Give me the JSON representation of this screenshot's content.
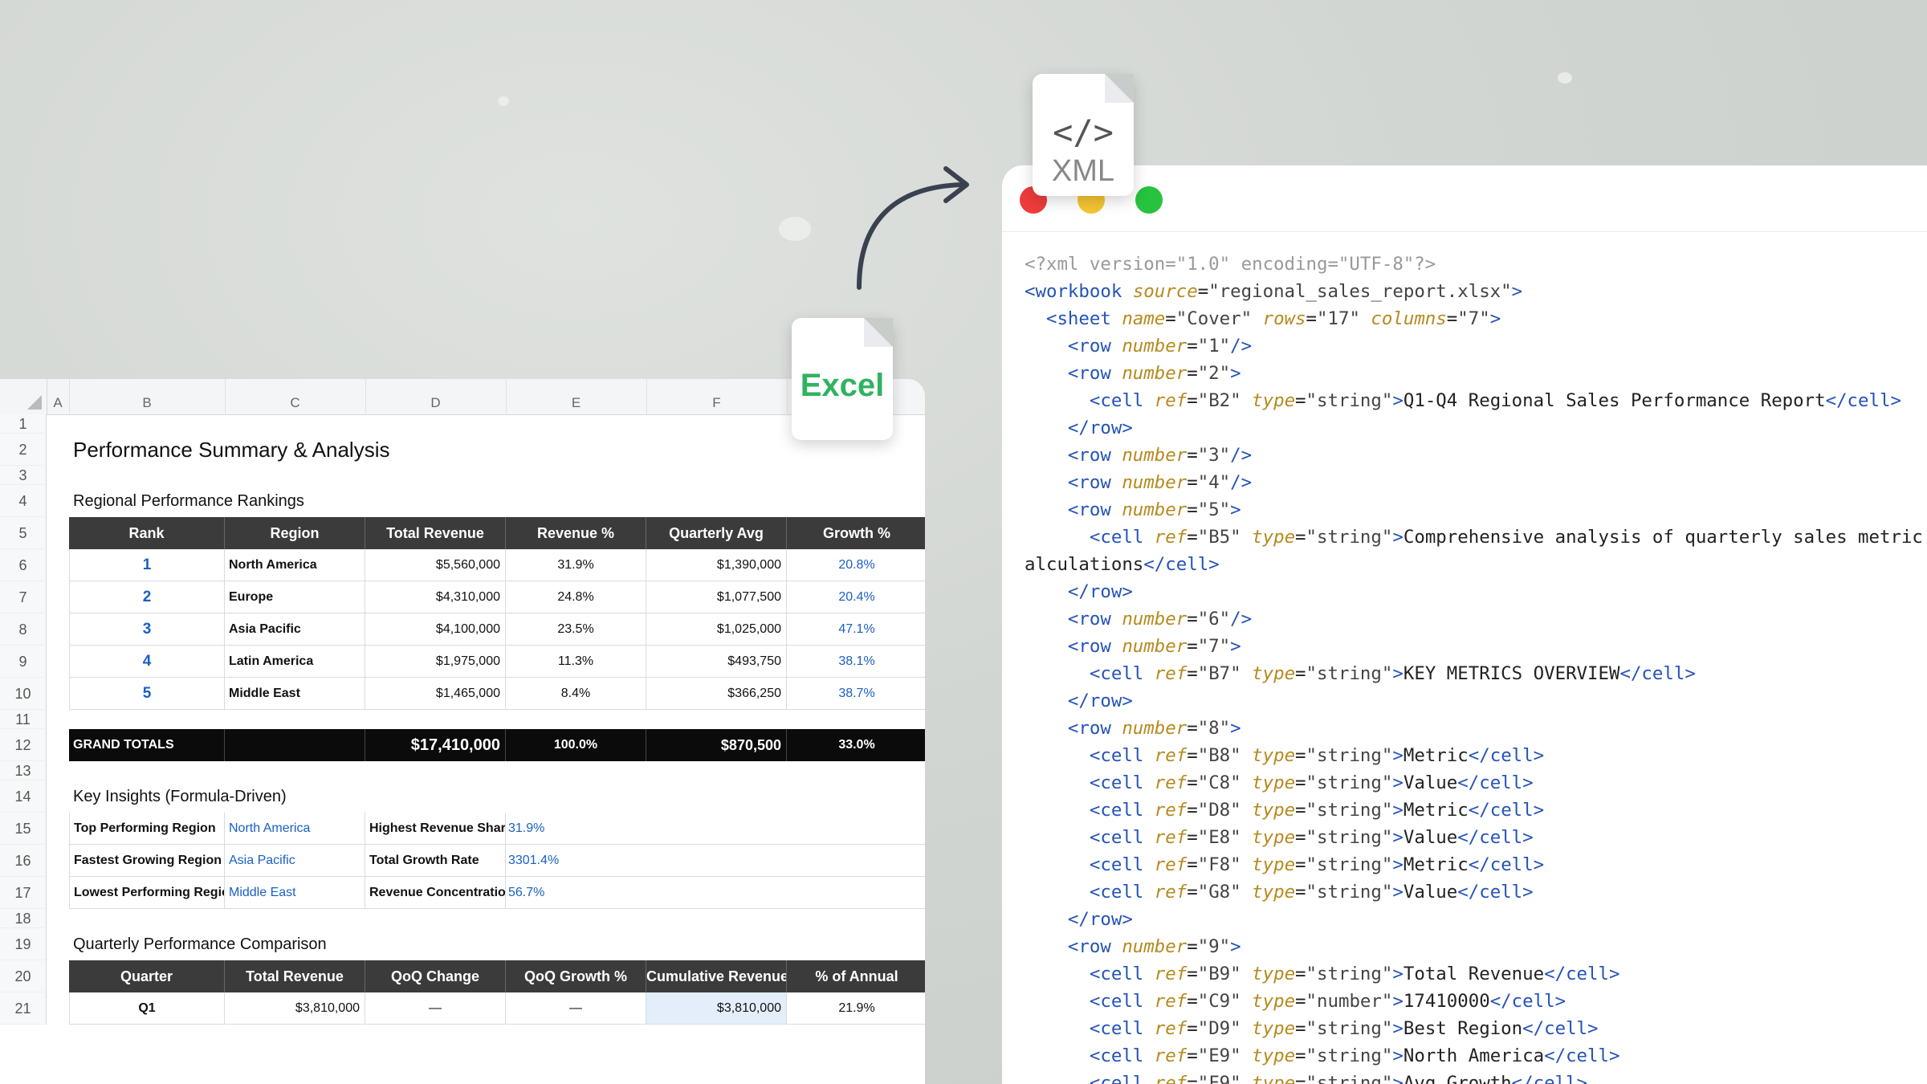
{
  "colors": {
    "accent_blue": "#1a5fc4",
    "header_dark": "#3b3b3b",
    "totals_black": "#0b0b0b",
    "excel_green": "#2fb360",
    "xml_tag": "#2453b8",
    "xml_attr": "#b58a1e",
    "mac_red": "#ee3b3b",
    "mac_yellow": "#f5c531",
    "mac_green": "#27c23e"
  },
  "icons": {
    "excel_badge": "excel-file-icon",
    "xml_badge": "xml-file-icon",
    "arrow": "curved-arrow-icon",
    "xml_code_glyph": "</>"
  },
  "excel_badge_label": "Excel",
  "xml_badge_label": "XML",
  "sheet": {
    "columns": [
      "A",
      "B",
      "C",
      "D",
      "E",
      "F"
    ],
    "rows": [
      "1",
      "2",
      "3",
      "4",
      "5",
      "6",
      "7",
      "8",
      "9",
      "10",
      "11",
      "12",
      "13",
      "14",
      "15",
      "16",
      "17",
      "18",
      "19",
      "20",
      "21"
    ],
    "title": "Performance Summary & Analysis",
    "rankings_title": "Regional Performance Rankings",
    "rankings_headers": [
      "Rank",
      "Region",
      "Total Revenue",
      "Revenue %",
      "Quarterly Avg",
      "Growth %"
    ],
    "rankings": [
      {
        "rank": "1",
        "region": "North America",
        "revenue": "$5,560,000",
        "pct": "31.9%",
        "avg": "$1,390,000",
        "growth": "20.8%"
      },
      {
        "rank": "2",
        "region": "Europe",
        "revenue": "$4,310,000",
        "pct": "24.8%",
        "avg": "$1,077,500",
        "growth": "20.4%"
      },
      {
        "rank": "3",
        "region": "Asia Pacific",
        "revenue": "$4,100,000",
        "pct": "23.5%",
        "avg": "$1,025,000",
        "growth": "47.1%"
      },
      {
        "rank": "4",
        "region": "Latin America",
        "revenue": "$1,975,000",
        "pct": "11.3%",
        "avg": "$493,750",
        "growth": "38.1%"
      },
      {
        "rank": "5",
        "region": "Middle East",
        "revenue": "$1,465,000",
        "pct": "8.4%",
        "avg": "$366,250",
        "growth": "38.7%"
      }
    ],
    "totals": {
      "label": "GRAND TOTALS",
      "revenue": "$17,410,000",
      "pct": "100.0%",
      "avg": "$870,500",
      "growth": "33.0%"
    },
    "insights_title": "Key Insights (Formula-Driven)",
    "insights": [
      {
        "k1": "Top Performing Region",
        "v1": "North America",
        "k2": "Highest Revenue Share",
        "v2": "31.9%"
      },
      {
        "k1": "Fastest Growing Region",
        "v1": "Asia Pacific",
        "k2": "Total Growth Rate",
        "v2": "3301.4%"
      },
      {
        "k1": "Lowest Performing Region",
        "v1": "Middle East",
        "k2": "Revenue Concentration",
        "v2": "56.7%"
      }
    ],
    "quarterly_title": "Quarterly Performance Comparison",
    "quarterly_headers": [
      "Quarter",
      "Total Revenue",
      "QoQ Change",
      "QoQ Growth %",
      "Cumulative Revenue",
      "% of Annual"
    ],
    "quarterly": [
      {
        "q": "Q1",
        "rev": "$3,810,000",
        "chg": "—",
        "gr": "—",
        "cum": "$3,810,000",
        "ann": "21.9%"
      }
    ]
  },
  "xml_lines": [
    [
      [
        "g",
        "<?xml version=\"1.0\" encoding=\"UTF-8\"?>"
      ]
    ],
    [
      [
        "t",
        "<workbook "
      ],
      [
        "a",
        "source"
      ],
      [
        "tx",
        "="
      ],
      [
        "v",
        "\"regional_sales_report.xlsx\""
      ],
      [
        "t",
        ">"
      ]
    ],
    [
      [
        "tx",
        "  "
      ],
      [
        "t",
        "<sheet "
      ],
      [
        "a",
        "name"
      ],
      [
        "tx",
        "="
      ],
      [
        "v",
        "\"Cover\" "
      ],
      [
        "a",
        "rows"
      ],
      [
        "tx",
        "="
      ],
      [
        "v",
        "\"17\" "
      ],
      [
        "a",
        "columns"
      ],
      [
        "tx",
        "="
      ],
      [
        "v",
        "\"7\""
      ],
      [
        "t",
        ">"
      ]
    ],
    [
      [
        "tx",
        "    "
      ],
      [
        "t",
        "<row "
      ],
      [
        "a",
        "number"
      ],
      [
        "tx",
        "="
      ],
      [
        "v",
        "\"1\""
      ],
      [
        "t",
        "/>"
      ]
    ],
    [
      [
        "tx",
        "    "
      ],
      [
        "t",
        "<row "
      ],
      [
        "a",
        "number"
      ],
      [
        "tx",
        "="
      ],
      [
        "v",
        "\"2\""
      ],
      [
        "t",
        ">"
      ]
    ],
    [
      [
        "tx",
        "      "
      ],
      [
        "t",
        "<cell "
      ],
      [
        "a",
        "ref"
      ],
      [
        "tx",
        "="
      ],
      [
        "v",
        "\"B2\" "
      ],
      [
        "a",
        "type"
      ],
      [
        "tx",
        "="
      ],
      [
        "v",
        "\"string\""
      ],
      [
        "t",
        ">"
      ],
      [
        "tx",
        "Q1-Q4 Regional Sales Performance Report"
      ],
      [
        "t",
        "</cell>"
      ]
    ],
    [
      [
        "tx",
        "    "
      ],
      [
        "t",
        "</row>"
      ]
    ],
    [
      [
        "tx",
        "    "
      ],
      [
        "t",
        "<row "
      ],
      [
        "a",
        "number"
      ],
      [
        "tx",
        "="
      ],
      [
        "v",
        "\"3\""
      ],
      [
        "t",
        "/>"
      ]
    ],
    [
      [
        "tx",
        "    "
      ],
      [
        "t",
        "<row "
      ],
      [
        "a",
        "number"
      ],
      [
        "tx",
        "="
      ],
      [
        "v",
        "\"4\""
      ],
      [
        "t",
        "/>"
      ]
    ],
    [
      [
        "tx",
        "    "
      ],
      [
        "t",
        "<row "
      ],
      [
        "a",
        "number"
      ],
      [
        "tx",
        "="
      ],
      [
        "v",
        "\"5\""
      ],
      [
        "t",
        ">"
      ]
    ],
    [
      [
        "tx",
        "      "
      ],
      [
        "t",
        "<cell "
      ],
      [
        "a",
        "ref"
      ],
      [
        "tx",
        "="
      ],
      [
        "v",
        "\"B5\" "
      ],
      [
        "a",
        "type"
      ],
      [
        "tx",
        "="
      ],
      [
        "v",
        "\"string\""
      ],
      [
        "t",
        ">"
      ],
      [
        "tx",
        "Comprehensive analysis of quarterly sales metric"
      ]
    ],
    [
      [
        "tx",
        "alculations"
      ],
      [
        "t",
        "</cell>"
      ]
    ],
    [
      [
        "tx",
        "    "
      ],
      [
        "t",
        "</row>"
      ]
    ],
    [
      [
        "tx",
        "    "
      ],
      [
        "t",
        "<row "
      ],
      [
        "a",
        "number"
      ],
      [
        "tx",
        "="
      ],
      [
        "v",
        "\"6\""
      ],
      [
        "t",
        "/>"
      ]
    ],
    [
      [
        "tx",
        "    "
      ],
      [
        "t",
        "<row "
      ],
      [
        "a",
        "number"
      ],
      [
        "tx",
        "="
      ],
      [
        "v",
        "\"7\""
      ],
      [
        "t",
        ">"
      ]
    ],
    [
      [
        "tx",
        "      "
      ],
      [
        "t",
        "<cell "
      ],
      [
        "a",
        "ref"
      ],
      [
        "tx",
        "="
      ],
      [
        "v",
        "\"B7\" "
      ],
      [
        "a",
        "type"
      ],
      [
        "tx",
        "="
      ],
      [
        "v",
        "\"string\""
      ],
      [
        "t",
        ">"
      ],
      [
        "tx",
        "KEY METRICS OVERVIEW"
      ],
      [
        "t",
        "</cell>"
      ]
    ],
    [
      [
        "tx",
        "    "
      ],
      [
        "t",
        "</row>"
      ]
    ],
    [
      [
        "tx",
        "    "
      ],
      [
        "t",
        "<row "
      ],
      [
        "a",
        "number"
      ],
      [
        "tx",
        "="
      ],
      [
        "v",
        "\"8\""
      ],
      [
        "t",
        ">"
      ]
    ],
    [
      [
        "tx",
        "      "
      ],
      [
        "t",
        "<cell "
      ],
      [
        "a",
        "ref"
      ],
      [
        "tx",
        "="
      ],
      [
        "v",
        "\"B8\" "
      ],
      [
        "a",
        "type"
      ],
      [
        "tx",
        "="
      ],
      [
        "v",
        "\"string\""
      ],
      [
        "t",
        ">"
      ],
      [
        "tx",
        "Metric"
      ],
      [
        "t",
        "</cell>"
      ]
    ],
    [
      [
        "tx",
        "      "
      ],
      [
        "t",
        "<cell "
      ],
      [
        "a",
        "ref"
      ],
      [
        "tx",
        "="
      ],
      [
        "v",
        "\"C8\" "
      ],
      [
        "a",
        "type"
      ],
      [
        "tx",
        "="
      ],
      [
        "v",
        "\"string\""
      ],
      [
        "t",
        ">"
      ],
      [
        "tx",
        "Value"
      ],
      [
        "t",
        "</cell>"
      ]
    ],
    [
      [
        "tx",
        "      "
      ],
      [
        "t",
        "<cell "
      ],
      [
        "a",
        "ref"
      ],
      [
        "tx",
        "="
      ],
      [
        "v",
        "\"D8\" "
      ],
      [
        "a",
        "type"
      ],
      [
        "tx",
        "="
      ],
      [
        "v",
        "\"string\""
      ],
      [
        "t",
        ">"
      ],
      [
        "tx",
        "Metric"
      ],
      [
        "t",
        "</cell>"
      ]
    ],
    [
      [
        "tx",
        "      "
      ],
      [
        "t",
        "<cell "
      ],
      [
        "a",
        "ref"
      ],
      [
        "tx",
        "="
      ],
      [
        "v",
        "\"E8\" "
      ],
      [
        "a",
        "type"
      ],
      [
        "tx",
        "="
      ],
      [
        "v",
        "\"string\""
      ],
      [
        "t",
        ">"
      ],
      [
        "tx",
        "Value"
      ],
      [
        "t",
        "</cell>"
      ]
    ],
    [
      [
        "tx",
        "      "
      ],
      [
        "t",
        "<cell "
      ],
      [
        "a",
        "ref"
      ],
      [
        "tx",
        "="
      ],
      [
        "v",
        "\"F8\" "
      ],
      [
        "a",
        "type"
      ],
      [
        "tx",
        "="
      ],
      [
        "v",
        "\"string\""
      ],
      [
        "t",
        ">"
      ],
      [
        "tx",
        "Metric"
      ],
      [
        "t",
        "</cell>"
      ]
    ],
    [
      [
        "tx",
        "      "
      ],
      [
        "t",
        "<cell "
      ],
      [
        "a",
        "ref"
      ],
      [
        "tx",
        "="
      ],
      [
        "v",
        "\"G8\" "
      ],
      [
        "a",
        "type"
      ],
      [
        "tx",
        "="
      ],
      [
        "v",
        "\"string\""
      ],
      [
        "t",
        ">"
      ],
      [
        "tx",
        "Value"
      ],
      [
        "t",
        "</cell>"
      ]
    ],
    [
      [
        "tx",
        "    "
      ],
      [
        "t",
        "</row>"
      ]
    ],
    [
      [
        "tx",
        "    "
      ],
      [
        "t",
        "<row "
      ],
      [
        "a",
        "number"
      ],
      [
        "tx",
        "="
      ],
      [
        "v",
        "\"9\""
      ],
      [
        "t",
        ">"
      ]
    ],
    [
      [
        "tx",
        "      "
      ],
      [
        "t",
        "<cell "
      ],
      [
        "a",
        "ref"
      ],
      [
        "tx",
        "="
      ],
      [
        "v",
        "\"B9\" "
      ],
      [
        "a",
        "type"
      ],
      [
        "tx",
        "="
      ],
      [
        "v",
        "\"string\""
      ],
      [
        "t",
        ">"
      ],
      [
        "tx",
        "Total Revenue"
      ],
      [
        "t",
        "</cell>"
      ]
    ],
    [
      [
        "tx",
        "      "
      ],
      [
        "t",
        "<cell "
      ],
      [
        "a",
        "ref"
      ],
      [
        "tx",
        "="
      ],
      [
        "v",
        "\"C9\" "
      ],
      [
        "a",
        "type"
      ],
      [
        "tx",
        "="
      ],
      [
        "v",
        "\"number\""
      ],
      [
        "t",
        ">"
      ],
      [
        "tx",
        "17410000"
      ],
      [
        "t",
        "</cell>"
      ]
    ],
    [
      [
        "tx",
        "      "
      ],
      [
        "t",
        "<cell "
      ],
      [
        "a",
        "ref"
      ],
      [
        "tx",
        "="
      ],
      [
        "v",
        "\"D9\" "
      ],
      [
        "a",
        "type"
      ],
      [
        "tx",
        "="
      ],
      [
        "v",
        "\"string\""
      ],
      [
        "t",
        ">"
      ],
      [
        "tx",
        "Best Region"
      ],
      [
        "t",
        "</cell>"
      ]
    ],
    [
      [
        "tx",
        "      "
      ],
      [
        "t",
        "<cell "
      ],
      [
        "a",
        "ref"
      ],
      [
        "tx",
        "="
      ],
      [
        "v",
        "\"E9\" "
      ],
      [
        "a",
        "type"
      ],
      [
        "tx",
        "="
      ],
      [
        "v",
        "\"string\""
      ],
      [
        "t",
        ">"
      ],
      [
        "tx",
        "North America"
      ],
      [
        "t",
        "</cell>"
      ]
    ],
    [
      [
        "tx",
        "      "
      ],
      [
        "t",
        "<cell "
      ],
      [
        "a",
        "ref"
      ],
      [
        "tx",
        "="
      ],
      [
        "v",
        "\"F9\" "
      ],
      [
        "a",
        "type"
      ],
      [
        "tx",
        "="
      ],
      [
        "v",
        "\"string\""
      ],
      [
        "t",
        ">"
      ],
      [
        "tx",
        "Avg Growth"
      ],
      [
        "t",
        "</cell>"
      ]
    ]
  ]
}
